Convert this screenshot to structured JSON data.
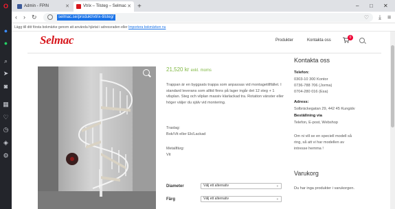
{
  "browser": {
    "tabs": [
      {
        "label": "Admin - FPIN",
        "active": false
      },
      {
        "label": "Vtrix – Tilsteg – Selmac",
        "active": true
      }
    ],
    "new_tab_label": "+",
    "window_controls": [
      "–",
      "□",
      "✕"
    ],
    "url": "selmac.se/produkt/vtrix-tilsteg/",
    "bookmark_hint": "Lägg till ditt första bokmärke genom att använda hjärtat i adressraden eller ",
    "bookmark_link": "Importera bokmärken nu",
    "accent_color": "#1a73e8"
  },
  "site": {
    "logo": "Selmac",
    "brand_color": "#d7161c",
    "nav": [
      "Produkter",
      "Kontakta oss"
    ],
    "cart_count": "0"
  },
  "product": {
    "price": "21,520 kr",
    "price_suffix": "exkl. moms",
    "price_color": "#7fb741",
    "description": "Trappan är en byggsats trappa som anpassas vid montagetillfället. I standard leverans som alltid finns på lager ingår det 12 steg + 1 vilsplan. Steg och vilplan massiv klarlackad tra. Rotation vänster eller höger väljer du själv vid montering.",
    "specs": [
      {
        "label": "Traslag:",
        "value": "Bok/Vit eller Ek/Lackad"
      },
      {
        "label": "Metallfärg:",
        "value": "Vit"
      }
    ],
    "options": [
      {
        "label": "Diameter",
        "value": "Välj ett alternativ"
      },
      {
        "label": "Färg",
        "value": "Välj ett alternativ"
      }
    ]
  },
  "contact": {
    "title": "Kontakta oss",
    "phone_label": "Telefon:",
    "phones": [
      "0303-10 300 Kontor",
      "0736-788 706 (Jorma)",
      "0704-280 016 (Esa)"
    ],
    "address_label": "Adress:",
    "address": "Solbräckegatan 29, 442 45 Kungälv",
    "order_label": "Beställning via",
    "order_value": "Telefon, E-post, Webshop",
    "note": [
      "Om ni vill se en speciell modell så",
      "ring, så att vi har modellen av",
      "intresse hemma !"
    ]
  },
  "cart": {
    "title": "Varukorg",
    "empty": "Du har inga produkter i varukorgen."
  },
  "sidebar_icons": [
    "opera-logo-icon",
    "messenger-icon",
    "whatsapp-icon",
    "search-icon",
    "send-icon",
    "camera-icon",
    "grid-icon",
    "heart-icon",
    "history-icon",
    "cube-icon",
    "gear-icon"
  ]
}
